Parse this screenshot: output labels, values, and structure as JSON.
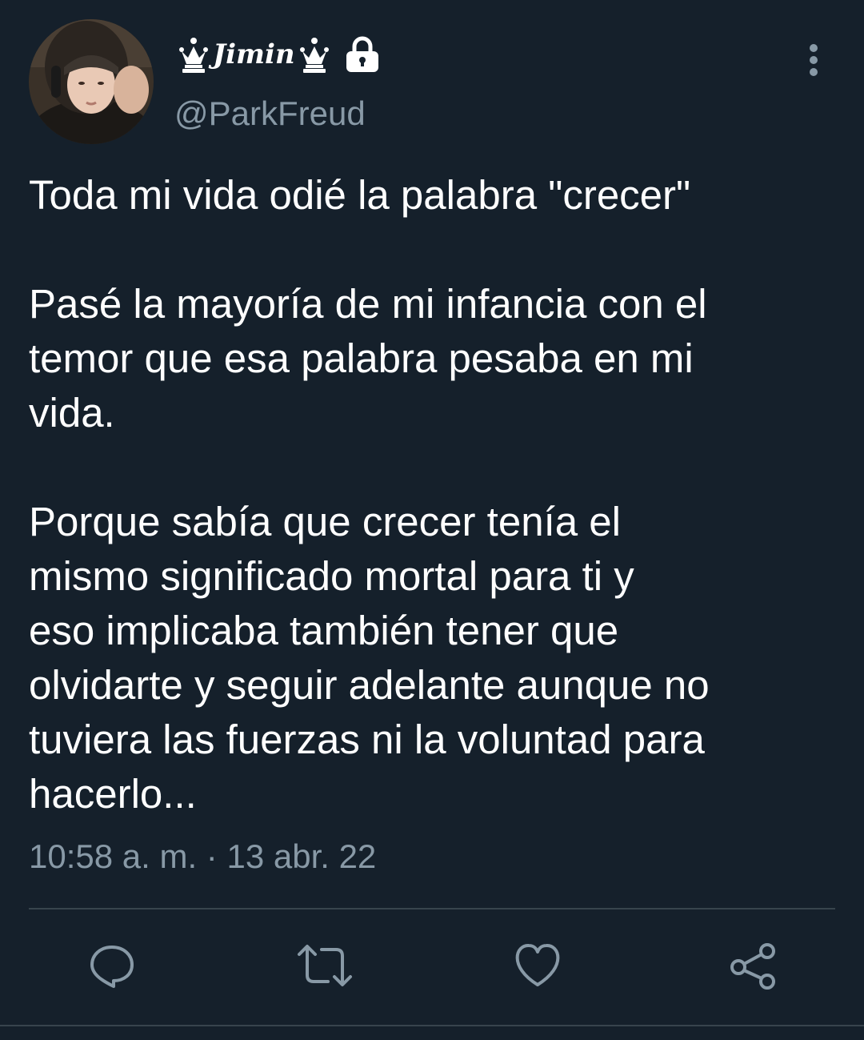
{
  "author": {
    "display_name": "Jimin",
    "display_name_decorations": [
      "white-chess-queen",
      "white-chess-queen"
    ],
    "handle": "@ParkFreud",
    "protected_icon": "lock-icon"
  },
  "tweet": {
    "paragraphs": [
      "Toda mi vida odié la palabra \"crecer\"",
      "Pasé la mayoría de mi infancia con el\ntemor que esa palabra pesaba en mi\nvida.",
      "Porque sabía que crecer tenía el\nmismo significado mortal para ti y\neso implicaba también tener que\nolvidarte y seguir adelante aunque no\ntuviera las fuerzas ni la voluntad para\nhacerlo..."
    ],
    "time": "10:58 a. m.",
    "separator": "·",
    "date": "13 abr. 22"
  },
  "actions": {
    "icons": [
      "reply-icon",
      "retweet-icon",
      "like-icon",
      "share-icon"
    ]
  },
  "colors": {
    "background": "#15202b",
    "text": "#ffffff",
    "secondary_text": "#8899a6",
    "divider": "#38444d",
    "action_icon": "#8899a6"
  }
}
